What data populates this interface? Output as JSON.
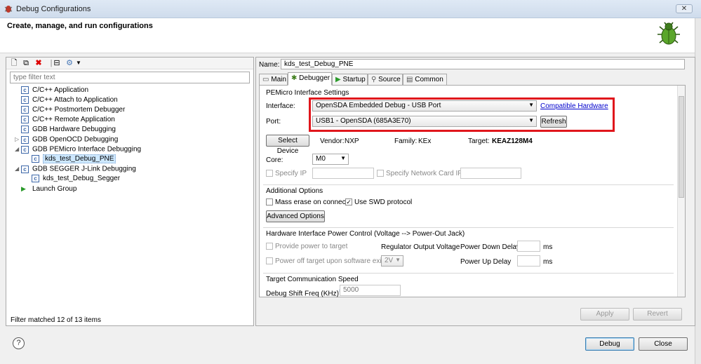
{
  "window": {
    "title": "Debug Configurations",
    "close": "✕"
  },
  "header": {
    "title": "Create, manage, and run configurations"
  },
  "left": {
    "filter_placeholder": "type filter text",
    "tree": [
      {
        "label": "C/C++ Application",
        "icon": "c-app-icon",
        "indent": 0,
        "twisty": ""
      },
      {
        "label": "C/C++ Attach to Application",
        "icon": "c-app-icon",
        "indent": 0,
        "twisty": ""
      },
      {
        "label": "C/C++ Postmortem Debugger",
        "icon": "c-app-icon",
        "indent": 0,
        "twisty": ""
      },
      {
        "label": "C/C++ Remote Application",
        "icon": "c-app-icon",
        "indent": 0,
        "twisty": ""
      },
      {
        "label": "GDB Hardware Debugging",
        "icon": "c-app-icon",
        "indent": 0,
        "twisty": ""
      },
      {
        "label": "GDB OpenOCD Debugging",
        "icon": "c-app-icon",
        "indent": 0,
        "twisty": "▷"
      },
      {
        "label": "GDB PEMicro Interface Debugging",
        "icon": "c-app-icon",
        "indent": 0,
        "twisty": "◢"
      },
      {
        "label": "kds_test_Debug_PNE",
        "icon": "c-app-icon",
        "indent": 1,
        "twisty": "",
        "selected": true
      },
      {
        "label": "GDB SEGGER J-Link Debugging",
        "icon": "c-app-icon",
        "indent": 0,
        "twisty": "◢"
      },
      {
        "label": "kds_test_Debug_Segger",
        "icon": "c-app-icon",
        "indent": 1,
        "twisty": ""
      },
      {
        "label": "Launch Group",
        "icon": "launch-group-icon",
        "indent": 0,
        "twisty": ""
      }
    ],
    "status": "Filter matched 12 of 13 items"
  },
  "name": {
    "label": "Name:",
    "value": "kds_test_Debug_PNE"
  },
  "tabs": [
    "Main",
    "Debugger",
    "Startup",
    "Source",
    "Common"
  ],
  "debugger": {
    "section_title": "PEMicro Interface Settings",
    "interface_label": "Interface:",
    "interface_value": "OpenSDA Embedded Debug - USB Port",
    "compatible_link": "Compatible Hardware",
    "port_label": "Port:",
    "port_value": "USB1 - OpenSDA (685A3E70)",
    "refresh": "Refresh",
    "select_device": "Select Device",
    "vendor_label": "Vendor:",
    "vendor_value": "NXP",
    "family_label": "Family:",
    "family_value": "KEx",
    "target_label": "Target:",
    "target_value": "KEAZ128M4",
    "core_label": "Core:",
    "core_value": "M0",
    "specify_ip": "Specify IP",
    "specify_net": "Specify Network Card IP",
    "additional_title": "Additional Options",
    "mass_erase": "Mass erase on connect",
    "use_swd": "Use SWD protocol",
    "advanced": "Advanced Options",
    "power_title": "Hardware Interface Power Control (Voltage --> Power-Out Jack)",
    "provide_power": "Provide power to target",
    "regulator": "Regulator Output Voltage",
    "power_down": "Power Down Delay",
    "power_off": "Power off target upon software exit",
    "voltage": "2V",
    "power_up": "Power Up Delay",
    "ms": "ms",
    "comm_title": "Target Communication Speed",
    "shift_freq": "Debug Shift Freq (KHz)",
    "shift_value": "5000"
  },
  "buttons": {
    "apply": "Apply",
    "revert": "Revert",
    "debug": "Debug",
    "close": "Close",
    "help": "?"
  },
  "colors": {
    "highlight": "#e0161c",
    "link": "#0000cc",
    "selection": "#cde8ff"
  }
}
